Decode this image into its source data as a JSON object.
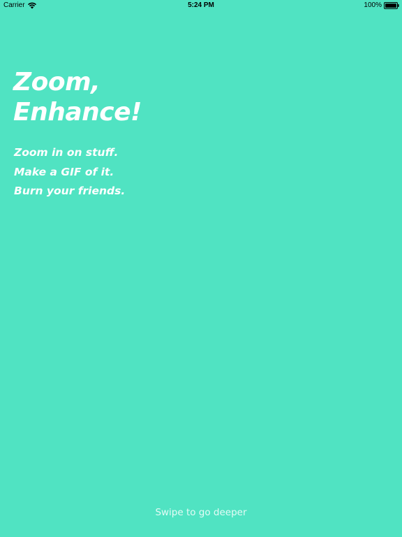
{
  "status_bar": {
    "carrier": "Carrier",
    "time": "5:24 PM",
    "battery_percent": "100%",
    "wifi_icon": "wifi-icon",
    "battery_icon": "battery-full-icon",
    "battery_level": 1.0
  },
  "hero": {
    "title_line1": "Zoom,",
    "title_line2": "Enhance!"
  },
  "taglines": [
    "Zoom in on stuff.",
    "Make a GIF of it.",
    "Burn your friends."
  ],
  "footer": {
    "swipe_hint": "Swipe to go deeper"
  },
  "colors": {
    "background": "#50e3c2",
    "text": "#ffffff"
  }
}
